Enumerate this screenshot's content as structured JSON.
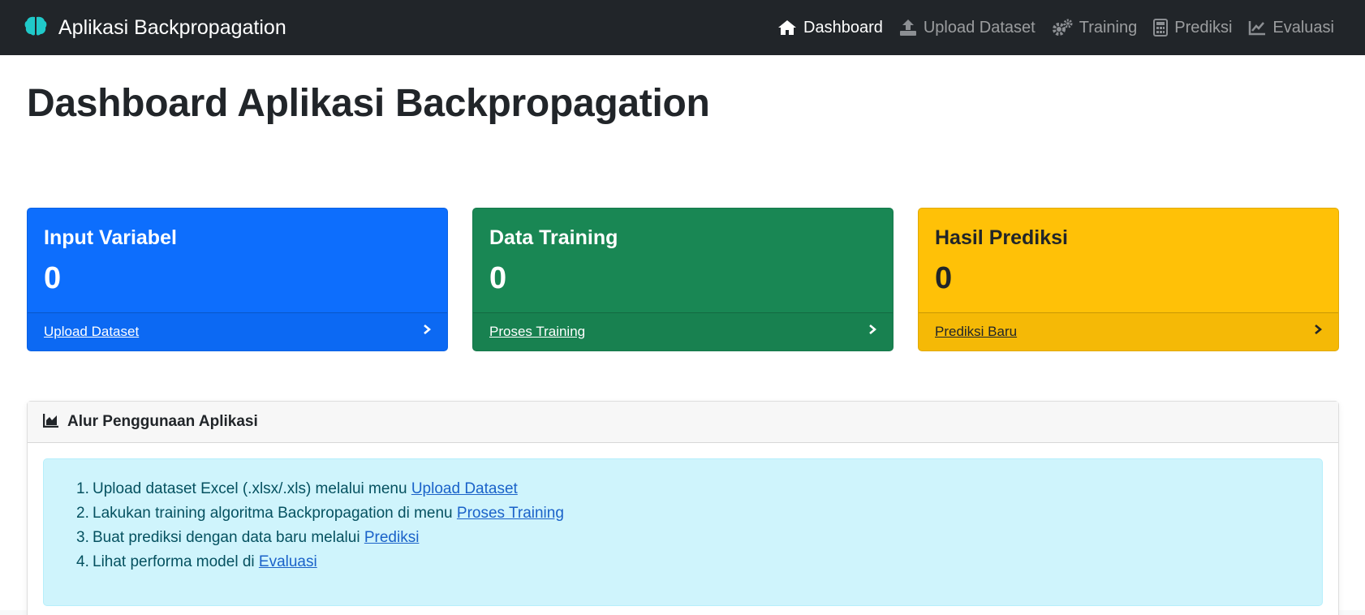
{
  "app": {
    "brand": "Aplikasi Backpropagation"
  },
  "nav": {
    "items": [
      {
        "label": "Dashboard",
        "icon": "home-icon",
        "active": true
      },
      {
        "label": "Upload Dataset",
        "icon": "upload-icon",
        "active": false
      },
      {
        "label": "Training",
        "icon": "gears-icon",
        "active": false
      },
      {
        "label": "Prediksi",
        "icon": "calculator-icon",
        "active": false
      },
      {
        "label": "Evaluasi",
        "icon": "line-chart-icon",
        "active": false
      }
    ]
  },
  "page": {
    "title": "Dashboard Aplikasi Backpropagation"
  },
  "cards": [
    {
      "title": "Input Variabel",
      "value": "0",
      "link": "Upload Dataset",
      "color": "#0d6efd"
    },
    {
      "title": "Data Training",
      "value": "0",
      "link": "Proses Training",
      "color": "#198754"
    },
    {
      "title": "Hasil Prediksi",
      "value": "0",
      "link": "Prediksi Baru",
      "color": "#ffc107"
    }
  ],
  "flow": {
    "title": "Alur Penggunaan Aplikasi",
    "steps": [
      {
        "num": "1.",
        "text": "Upload dataset Excel (.xlsx/.xls) melalui menu ",
        "link": "Upload Dataset"
      },
      {
        "num": "2.",
        "text": "Lakukan training algoritma Backpropagation di menu ",
        "link": "Proses Training"
      },
      {
        "num": "3.",
        "text": "Buat prediksi dengan data baru melalui ",
        "link": "Prediksi"
      },
      {
        "num": "4.",
        "text": "Lihat performa model di ",
        "link": "Evaluasi"
      }
    ]
  },
  "colors": {
    "navbar": "#212529",
    "brand_icon": "#20c9c9",
    "info_bg": "#cff4fc"
  }
}
